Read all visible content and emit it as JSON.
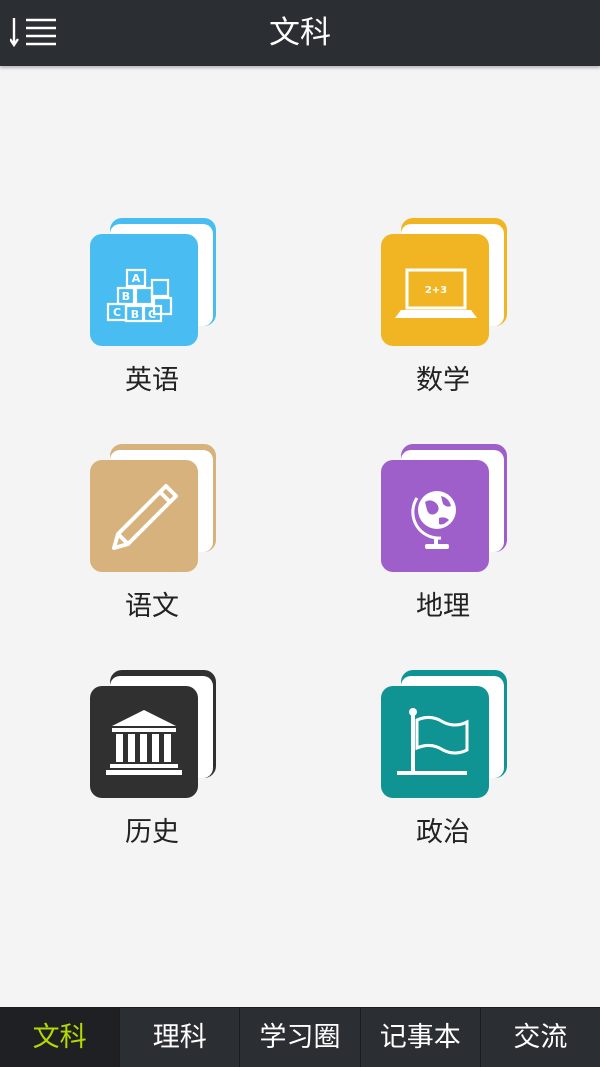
{
  "header": {
    "title": "文科"
  },
  "subjects": [
    {
      "label": "英语",
      "color": "#49bdf1",
      "icon": "abc-blocks-icon"
    },
    {
      "label": "数学",
      "color": "#f1b524",
      "icon": "laptop-math-icon"
    },
    {
      "label": "语文",
      "color": "#d7b27c",
      "icon": "pencil-icon"
    },
    {
      "label": "地理",
      "color": "#9e5fcb",
      "icon": "globe-icon"
    },
    {
      "label": "历史",
      "color": "#303030",
      "icon": "museum-icon"
    },
    {
      "label": "政治",
      "color": "#109393",
      "icon": "flag-icon"
    }
  ],
  "tabbar": {
    "active_color": "#b5d800",
    "items": [
      {
        "label": "文科",
        "active": true
      },
      {
        "label": "理科",
        "active": false
      },
      {
        "label": "学习圈",
        "active": false
      },
      {
        "label": "记事本",
        "active": false
      },
      {
        "label": "交流",
        "active": false
      }
    ]
  },
  "blocks": {
    "letters": [
      "A",
      "B",
      "C",
      "B",
      "C"
    ]
  },
  "math": {
    "screen_text": "2+3"
  }
}
